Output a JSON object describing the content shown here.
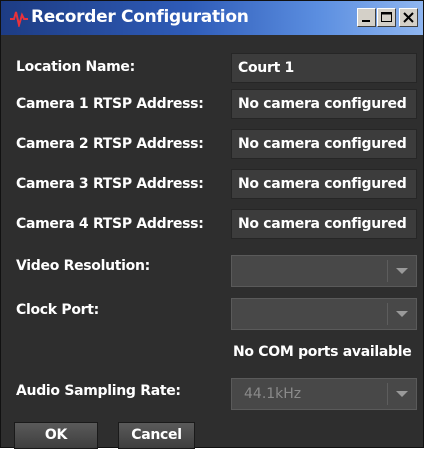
{
  "window": {
    "title": "Recorder Configuration"
  },
  "form": {
    "location_label": "Location Name:",
    "location_value": "Court 1",
    "cameras": [
      {
        "label": "Camera 1 RTSP Address:",
        "value": "No camera configured"
      },
      {
        "label": "Camera 2 RTSP Address:",
        "value": "No camera configured"
      },
      {
        "label": "Camera 3 RTSP Address:",
        "value": "No camera configured"
      },
      {
        "label": "Camera 4 RTSP Address:",
        "value": "No camera configured"
      }
    ],
    "video_resolution_label": "Video Resolution:",
    "video_resolution_value": "",
    "clock_port_label": "Clock Port:",
    "clock_port_value": "",
    "com_ports_note": "No COM ports available",
    "audio_rate_label": "Audio Sampling Rate:",
    "audio_rate_value": "44.1kHz"
  },
  "buttons": {
    "ok": "OK",
    "cancel": "Cancel"
  }
}
